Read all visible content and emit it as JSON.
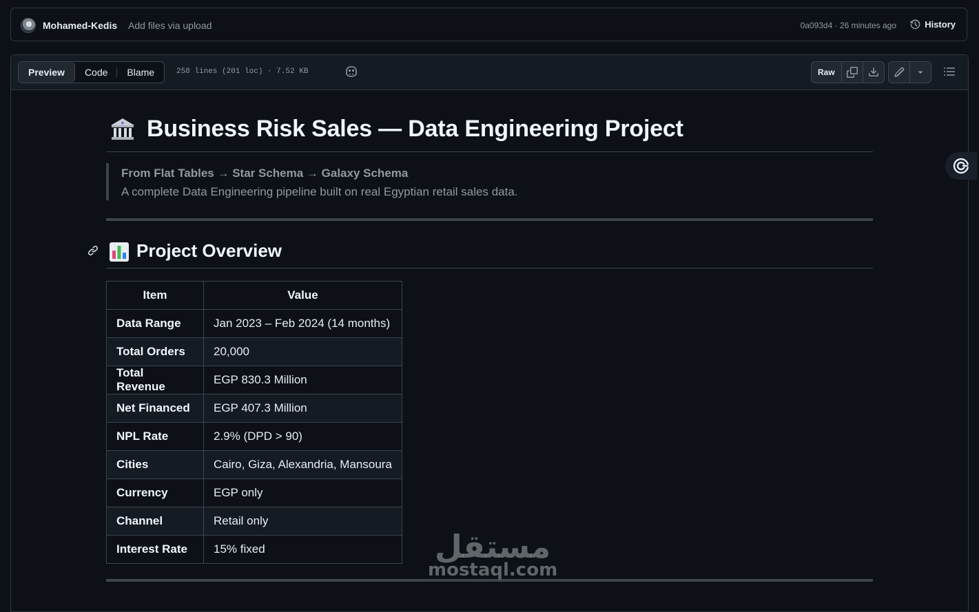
{
  "commit": {
    "author": "Mohamed-Kedis",
    "message": "Add files via upload",
    "meta": "0a093d4 · 26 minutes ago",
    "history_label": "History"
  },
  "file_header": {
    "tabs": [
      "Preview",
      "Code",
      "Blame"
    ],
    "active_tab": "Preview",
    "info": "258 lines (201 loc) · 7.52 KB",
    "raw_label": "Raw"
  },
  "doc": {
    "title": "Business Risk Sales — Data Engineering Project",
    "title_emoji": "🏛️",
    "quote_line1": "From Flat Tables → Star Schema → Galaxy Schema",
    "quote_line2": "A complete Data Engineering pipeline built on real Egyptian retail sales data.",
    "section_emoji": "📊",
    "section_title": "Project Overview",
    "table": {
      "headers": [
        "Item",
        "Value"
      ],
      "rows": [
        [
          "Data Range",
          "Jan 2023 – Feb 2024 (14 months)"
        ],
        [
          "Total Orders",
          "20,000"
        ],
        [
          "Total Revenue",
          "EGP 830.3 Million"
        ],
        [
          "Net Financed",
          "EGP 407.3 Million"
        ],
        [
          "NPL Rate",
          "2.9% (DPD > 90)"
        ],
        [
          "Cities",
          "Cairo, Giza, Alexandria, Mansoura"
        ],
        [
          "Currency",
          "EGP only"
        ],
        [
          "Channel",
          "Retail only"
        ],
        [
          "Interest Rate",
          "15% fixed"
        ]
      ]
    }
  },
  "watermark": {
    "arabic": "مستقل",
    "latin": "mostaql.com"
  }
}
